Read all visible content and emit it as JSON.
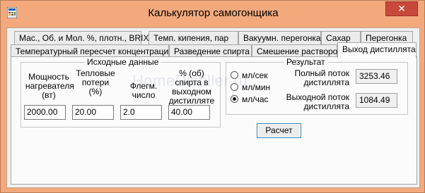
{
  "window": {
    "title": "Калькулятор самогонщика",
    "close_glyph": "✕"
  },
  "tabs_row1": [
    {
      "label": "Мас., Об. и Мол. %, плотн., BRIX"
    },
    {
      "label": "Темп. кипения, пар"
    },
    {
      "label": "Вакуумн. перегонка"
    },
    {
      "label": "Сахар"
    },
    {
      "label": "Перегонка"
    }
  ],
  "tabs_row2": [
    {
      "label": "Температурный пересчет концентрации"
    },
    {
      "label": "Разведение спирта"
    },
    {
      "label": "Смешение растворов"
    },
    {
      "label": "Выход дистиллята",
      "active": true
    }
  ],
  "source": {
    "group_title": "Исходные данные",
    "power_label": "Мощность нагревателя (вт)",
    "power_value": "2000.00",
    "heat_loss_label": "Тепловые потери (%)",
    "heat_loss_value": "20.00",
    "reflux_label": "Флегм. число",
    "reflux_value": "2.0",
    "abv_label": "% (об) спирта в выходном дистилляте",
    "abv_value": "40.00"
  },
  "result": {
    "group_title": "Результат",
    "units": [
      {
        "label": "мл/сек",
        "checked": false
      },
      {
        "label": "мл/мин",
        "checked": false
      },
      {
        "label": "мл/час",
        "checked": true
      }
    ],
    "full_flow_label": "Полный поток дистиллята",
    "full_flow_value": "3253.46",
    "output_flow_label": "Выходной поток дистиллята",
    "output_flow_value": "1084.49"
  },
  "calculate_button": "Расчет",
  "watermark": "HomeDistiller.ru"
}
